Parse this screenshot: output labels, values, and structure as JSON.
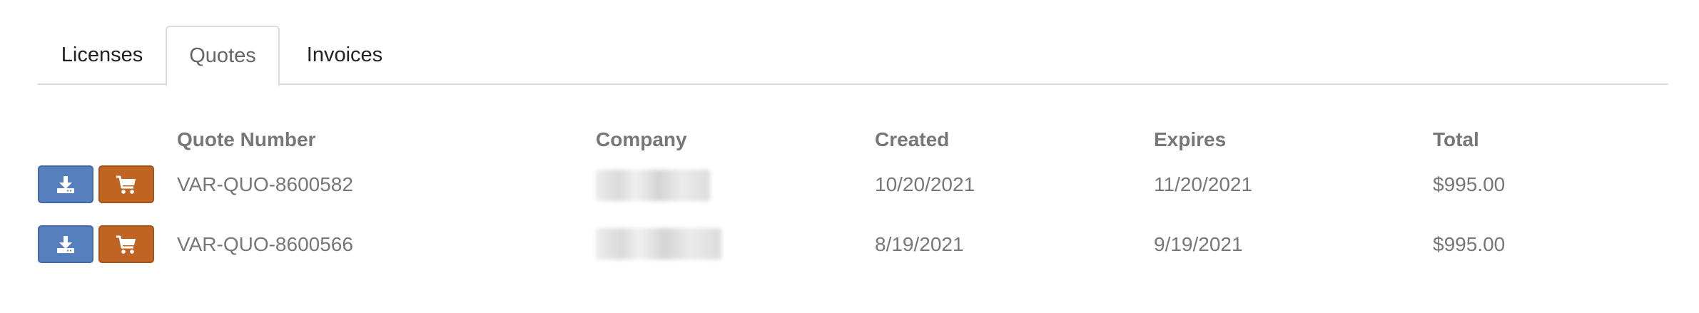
{
  "tabs": [
    {
      "label": "Licenses",
      "active": false
    },
    {
      "label": "Quotes",
      "active": true
    },
    {
      "label": "Invoices",
      "active": false
    }
  ],
  "table": {
    "headers": {
      "quote_number": "Quote Number",
      "company": "Company",
      "created": "Created",
      "expires": "Expires",
      "total": "Total"
    },
    "rows": [
      {
        "quote_number": "VAR-QUO-8600582",
        "company": "",
        "created": "10/20/2021",
        "expires": "11/20/2021",
        "total": "$995.00"
      },
      {
        "quote_number": "VAR-QUO-8600566",
        "company": "",
        "created": "8/19/2021",
        "expires": "9/19/2021",
        "total": "$995.00"
      }
    ]
  },
  "icons": {
    "download": "download-icon",
    "cart": "cart-icon"
  },
  "colors": {
    "download_button": "#5580bd",
    "cart_button": "#c06424",
    "header_text": "#777777",
    "tab_border": "#dcdcdc"
  }
}
